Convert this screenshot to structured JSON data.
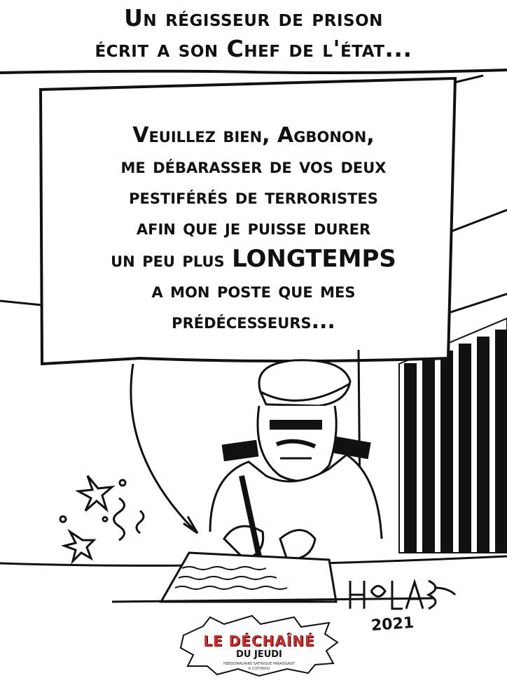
{
  "title": {
    "line1": "Un régisseur de prison",
    "line2": "écrit a son Chef de l'état..."
  },
  "speech_bubble": {
    "line1": "Veuillez bien, Agbonon,",
    "line2": "me débarasser de vos deux",
    "line3": "pestiférés de terroristes",
    "line4": "afin que je puisse durer",
    "line5_prefix": "un peu plus ",
    "line5_emphasis": "LONGTEMPS",
    "line6": "a mon poste que mes",
    "line7": "prédécesseurs..."
  },
  "signature": {
    "year": "2021"
  },
  "logo": {
    "name": "LE DÉCHAÎNÉ",
    "subtitle": "DU JEUDI",
    "tagline_1": "HEBDOMADAIRE SATIRIQUE PARAISSANT",
    "tagline_2": "A COTONOU"
  },
  "colors": {
    "ink": "#111111",
    "paper": "#ffffff",
    "logo_red": "#d42a2a"
  }
}
